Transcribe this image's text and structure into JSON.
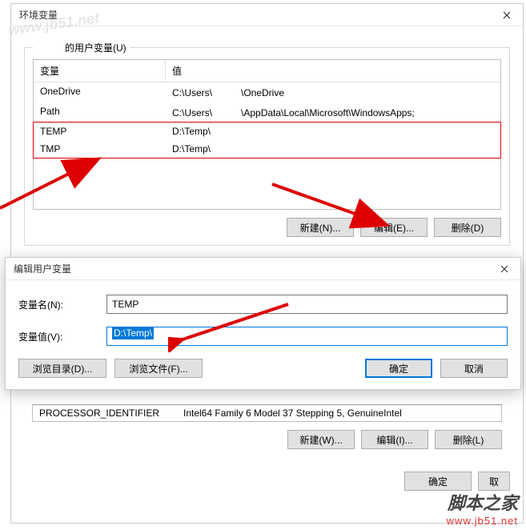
{
  "envWin": {
    "title": "环境变量",
    "userVarsLabel": "的用户变量(U)",
    "headers": {
      "var": "变量",
      "val": "值"
    },
    "rows": [
      {
        "var": "OneDrive",
        "val": "C:\\Users\\　　　\\OneDrive"
      },
      {
        "var": "Path",
        "val": "C:\\Users\\　　　\\AppData\\Local\\Microsoft\\WindowsApps;"
      },
      {
        "var": "TEMP",
        "val": "D:\\Temp\\"
      },
      {
        "var": "TMP",
        "val": "D:\\Temp\\"
      }
    ],
    "btns": {
      "new": "新建(N)...",
      "edit": "编辑(E)...",
      "del": "删除(D)"
    },
    "sysRow": {
      "var": "PROCESSOR_IDENTIFIER",
      "val": "Intel64 Family 6 Model 37 Stepping 5, GenuineIntel"
    },
    "sysBtns": {
      "new": "新建(W)...",
      "edit": "编辑(I)...",
      "del": "删除(L)"
    },
    "mainBtns": {
      "ok": "确定",
      "cancel": "取"
    }
  },
  "editDlg": {
    "title": "编辑用户变量",
    "nameLabel": "变量名(N):",
    "nameValue": "TEMP",
    "valLabel": "变量值(V):",
    "valValue": "D:\\Temp\\",
    "btns": {
      "browseDir": "浏览目录(D)...",
      "browseFile": "浏览文件(F)...",
      "ok": "确定",
      "cancel": "取消"
    }
  },
  "watermark": {
    "site": "脚本之家",
    "url": "www.jb51.net"
  }
}
